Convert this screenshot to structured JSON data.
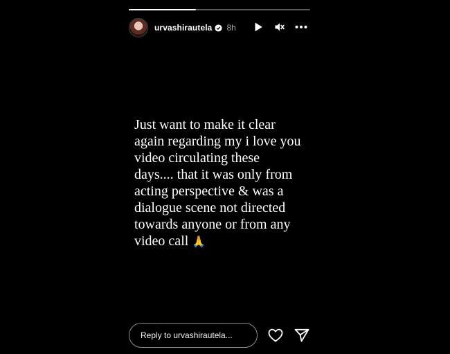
{
  "story": {
    "progress_fraction": 0.37,
    "user": {
      "username": "urvashirautela",
      "verified": true,
      "time_ago": "8h"
    },
    "controls": {
      "play_icon": "play-icon",
      "mute_icon": "muted-speaker-icon",
      "more_icon": "more-horizontal-icon"
    },
    "text_lines": [
      "Just want to make it clear",
      "again regarding my i love you",
      "video circulating these",
      "days.... that it was only from",
      "acting perspective & was a",
      "dialogue scene not directed",
      "towards anyone or from any",
      "video call"
    ],
    "text_emoji": "🙏",
    "footer": {
      "reply_placeholder": "Reply to urvashirautela...",
      "like_icon": "heart-icon",
      "share_icon": "send-icon"
    }
  },
  "colors": {
    "background": "#000000",
    "text": "#ffffff",
    "muted_text": "#a8a8a8",
    "verified_badge": "#3897f0"
  }
}
